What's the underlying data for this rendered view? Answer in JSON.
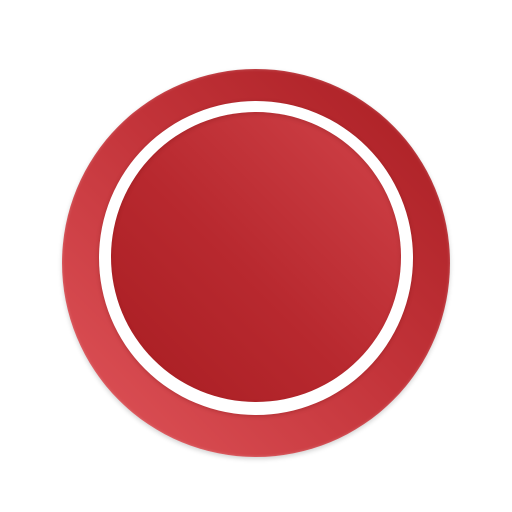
{
  "control": {
    "type": "record-button",
    "icon": "record-icon",
    "colors": {
      "outer_light": "#e0555a",
      "outer_mid": "#c3343a",
      "outer_dark": "#a81d22",
      "ring": "#ffffff",
      "core_light": "#d14349",
      "core_mid": "#b8292f",
      "core_dark": "#a81d22"
    }
  }
}
